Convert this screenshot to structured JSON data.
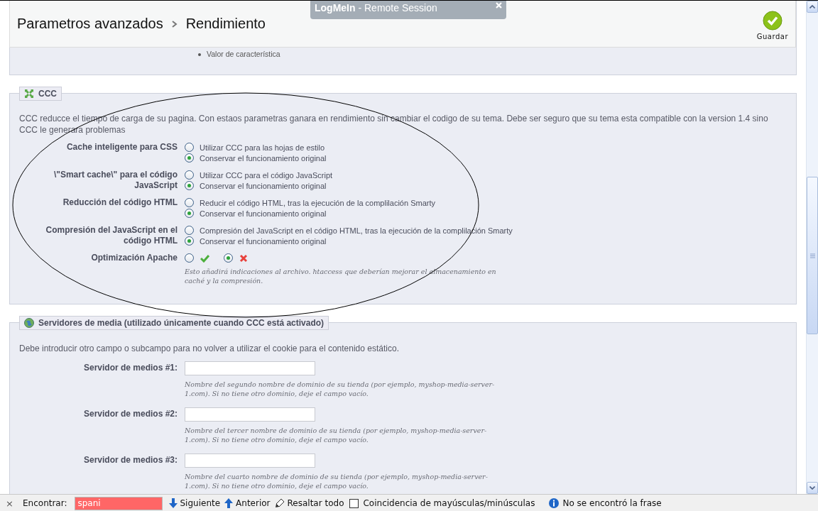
{
  "header": {
    "breadcrumb": [
      "Parametros avanzados",
      "Rendimiento"
    ],
    "save_button": "Guardar"
  },
  "remote_session": {
    "brand": "LogMeIn",
    "title": " - Remote Session"
  },
  "features_panel": {
    "items": [
      "Valor de característica"
    ]
  },
  "ccc": {
    "legend": "CCC",
    "description": "CCC reducce el tiempo de carga de su pagina. Con estaos parametras ganara en rendimiento sin cambiar el codigo de su tema. Debe ser seguro que su tema esta compatible con la version 1.4 sino CCC le generara problemas",
    "settings": [
      {
        "kind": "choice",
        "label": "Cache inteligente para CSS",
        "options": [
          {
            "label": "Utilizar CCC para las hojas de estilo",
            "selected": false
          },
          {
            "label": "Conservar el funcionamiento original",
            "selected": true
          }
        ]
      },
      {
        "kind": "choice",
        "label": "\\\"Smart cache\\\" para el código JavaScript",
        "options": [
          {
            "label": "Utilizar CCC para el código JavaScript",
            "selected": false
          },
          {
            "label": "Conservar el funcionamiento original",
            "selected": true
          }
        ]
      },
      {
        "kind": "choice",
        "label": "Reducción del código HTML",
        "options": [
          {
            "label": "Reducir el código HTML, tras la ejecución de la complilación Smarty",
            "selected": false
          },
          {
            "label": "Conservar el funcionamiento original",
            "selected": true
          }
        ]
      },
      {
        "kind": "choice",
        "label": "Compresión del JavaScript en el código HTML",
        "options": [
          {
            "label": "Compresión del JavaScript en el código HTML, tras la ejecución de la complilación Smarty",
            "selected": false
          },
          {
            "label": "Conservar el funcionamiento original",
            "selected": true
          }
        ]
      },
      {
        "kind": "toggle",
        "label": "Optimización Apache",
        "options": [
          {
            "kind": "yes",
            "selected": false
          },
          {
            "kind": "no",
            "selected": true
          }
        ],
        "hint": "Esto añadirá indicaciones al archivo. htaccess que deberían mejorar el almacenamiento en caché y la compresión."
      }
    ]
  },
  "media": {
    "legend": "Servidores de media (utilizado únicamente cuando CCC está activado)",
    "description": "Debe introducir otro campo o subcampo para no volver a utilizar el cookie para el contenido estático.",
    "servers": [
      {
        "label": "Servidor de medios #1:",
        "hint": "Nombre del segundo nombre de dominio de su tienda (por ejemplo, myshop-media-server-1.com). Si no tiene otro dominio, deje el campo vacío."
      },
      {
        "label": "Servidor de medios #2:",
        "hint": "Nombre del tercer nombre de dominio de su tienda (por ejemplo, myshop-media-server-1.com). Si no tiene otro dominio, deje el campo vacío."
      },
      {
        "label": "Servidor de medios #3:",
        "hint": "Nombre del cuarto nombre de dominio de su tienda (por ejemplo, myshop-media-server-1.com). Si no tiene otro dominio, deje el campo vacío."
      }
    ]
  },
  "find_bar": {
    "close": "×",
    "label": "Encontrar:",
    "query": "spani",
    "not_found": true,
    "buttons": [
      {
        "kind": "next",
        "label": "Siguiente"
      },
      {
        "kind": "previous",
        "label": "Anterior"
      },
      {
        "kind": "highlight",
        "label": "Resaltar todo"
      }
    ],
    "match_case": {
      "label": "Coincidencia de mayúsculas/minúsculas",
      "checked": false
    },
    "status": "No se encontró la frase"
  }
}
